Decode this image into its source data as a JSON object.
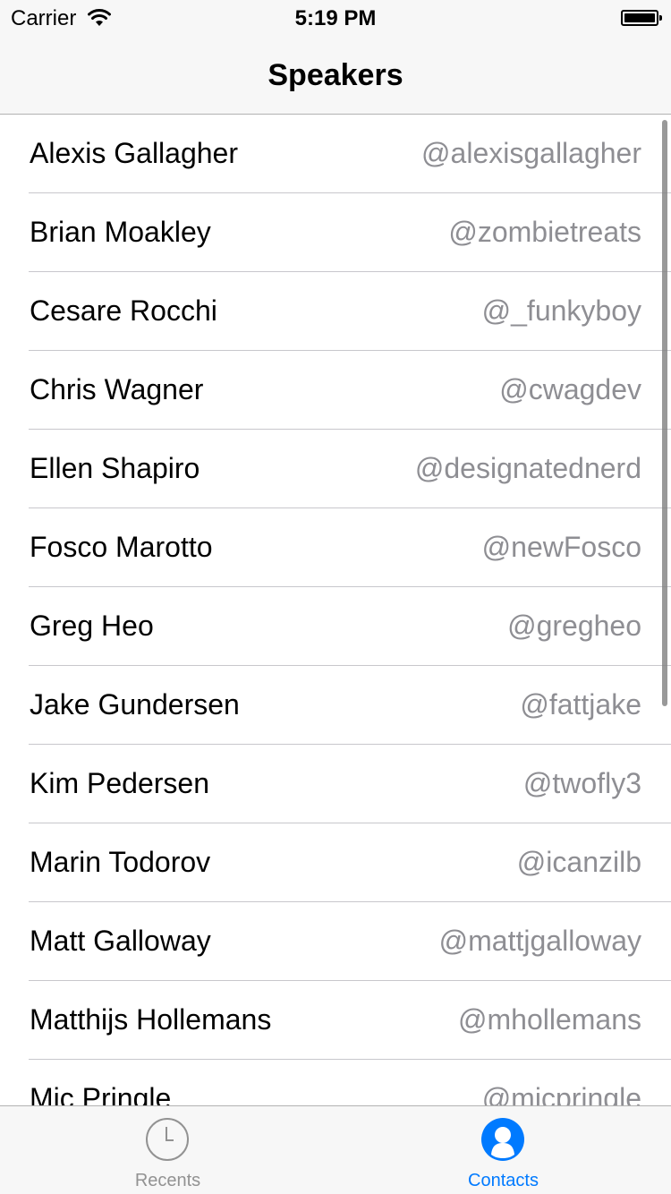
{
  "status_bar": {
    "carrier": "Carrier",
    "time": "5:19 PM",
    "wifi_icon": "wifi-icon",
    "battery_icon": "battery-icon"
  },
  "nav": {
    "title": "Speakers"
  },
  "speakers": [
    {
      "name": "Alexis Gallagher",
      "handle": "@alexisgallagher"
    },
    {
      "name": "Brian Moakley",
      "handle": "@zombietreats"
    },
    {
      "name": "Cesare Rocchi",
      "handle": "@_funkyboy"
    },
    {
      "name": "Chris Wagner",
      "handle": "@cwagdev"
    },
    {
      "name": "Ellen Shapiro",
      "handle": "@designatednerd"
    },
    {
      "name": "Fosco Marotto",
      "handle": "@newFosco"
    },
    {
      "name": "Greg Heo",
      "handle": "@gregheo"
    },
    {
      "name": "Jake Gundersen",
      "handle": "@fattjake"
    },
    {
      "name": "Kim Pedersen",
      "handle": "@twofly3"
    },
    {
      "name": "Marin Todorov",
      "handle": "@icanzilb"
    },
    {
      "name": "Matt Galloway",
      "handle": "@mattjgalloway"
    },
    {
      "name": "Matthijs Hollemans",
      "handle": "@mhollemans"
    },
    {
      "name": "Mic Pringle",
      "handle": "@micpringle"
    }
  ],
  "tab_bar": {
    "tabs": [
      {
        "label": "Recents",
        "icon": "clock-icon",
        "selected": false
      },
      {
        "label": "Contacts",
        "icon": "contact-icon",
        "selected": true
      }
    ]
  },
  "colors": {
    "accent": "#007aff",
    "inactive": "#929292",
    "handle_gray": "#8e8e93"
  }
}
